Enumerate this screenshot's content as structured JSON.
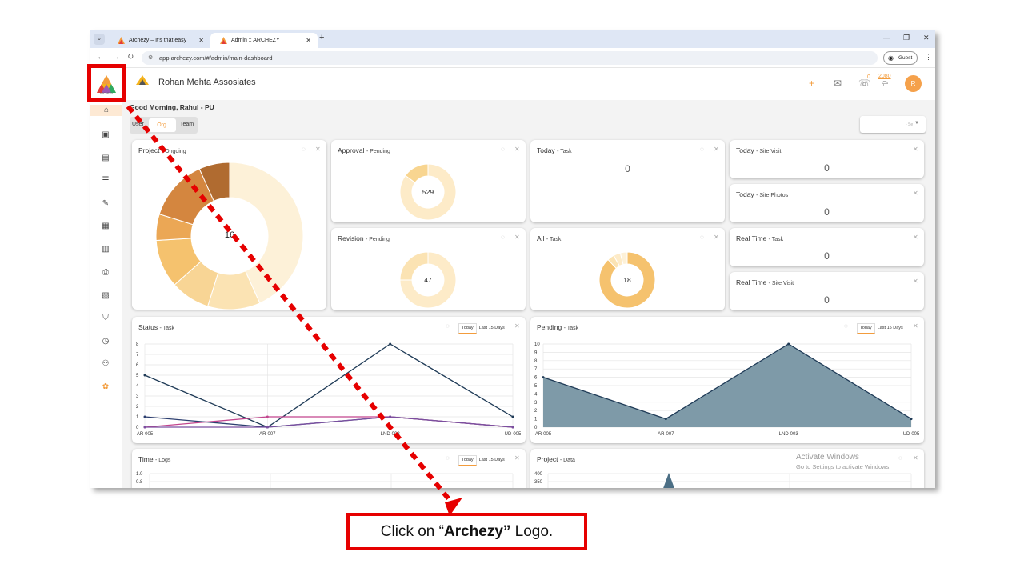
{
  "browser": {
    "tabs": [
      {
        "title": "Archezy – It's that easy",
        "active": false
      },
      {
        "title": "Admin :: ARCHEZY",
        "active": true
      }
    ],
    "url": "app.archezy.com/#/admin/main-dashboard",
    "profile_label": "Guest"
  },
  "sidebar": {
    "logo_text": "ARCHEZY",
    "items": [
      "home-icon",
      "badge-icon",
      "clipboard-clock-icon",
      "checklist-icon",
      "edit-note-icon",
      "receipt-icon",
      "book-icon",
      "printer-icon",
      "photo-folder-icon",
      "shield-icon",
      "calendar-clock-icon",
      "org-chart-icon",
      "gift-icon"
    ]
  },
  "header": {
    "company_name": "Rohan Mehta Assosiates",
    "notifications_count": "0",
    "alerts_count": "2080",
    "avatar_initial": "R",
    "accent_color": "#f39c3c"
  },
  "dashboard": {
    "greeting": "Good Morning, Rahul - PU",
    "scope_options": {
      "user": "User",
      "org": "Org.",
      "team": "Team"
    },
    "select_placeholder": "- Se"
  },
  "cards": {
    "project": {
      "title": "Project",
      "subtitle": "- Ongoing",
      "value": "16"
    },
    "approval": {
      "title": "Approval",
      "subtitle": "- Pending",
      "value": "529"
    },
    "revision": {
      "title": "Revision",
      "subtitle": "- Pending",
      "value": "47"
    },
    "today_task": {
      "title": "Today",
      "subtitle": "- Task",
      "value": "0"
    },
    "all_task": {
      "title": "All",
      "subtitle": "- Task",
      "value": "18"
    },
    "today_site_visit": {
      "title": "Today",
      "subtitle": "- Site Visit",
      "value": "0"
    },
    "today_site_photos": {
      "title": "Today",
      "subtitle": "- Site Photos",
      "value": "0"
    },
    "realtime_task": {
      "title": "Real Time",
      "subtitle": "- Task",
      "value": "0"
    },
    "realtime_site_visit": {
      "title": "Real Time",
      "subtitle": "- Site Visit",
      "value": "0"
    },
    "status_task": {
      "title": "Status",
      "subtitle": "- Task"
    },
    "pending_task": {
      "title": "Pending",
      "subtitle": "- Task"
    },
    "time_logs": {
      "title": "Time",
      "subtitle": "- Logs"
    },
    "project_data": {
      "title": "Project",
      "subtitle": "- Data"
    }
  },
  "range": {
    "today": "Today",
    "last15": "Last 15 Days"
  },
  "chart_data": [
    {
      "type": "pie",
      "values": [
        45,
        12,
        9,
        11,
        6,
        14,
        7
      ],
      "colors": [
        "#fdf1d8",
        "#fbe3b3",
        "#f8d595",
        "#f5c26e",
        "#eba755",
        "#d4863f",
        "#b06b30"
      ]
    },
    {
      "type": "pie",
      "values": [
        85,
        15
      ],
      "colors": [
        "#fdebc8",
        "#f8d590"
      ]
    },
    {
      "type": "pie",
      "values": [
        75,
        25
      ],
      "colors": [
        "#fdebc8",
        "#fbe3b3"
      ]
    },
    {
      "type": "pie",
      "values": [
        88,
        4,
        4,
        4
      ],
      "colors": [
        "#f5c26e",
        "#fbe3b3",
        "#fdebc8",
        "#fdf1d8"
      ]
    },
    {
      "type": "line",
      "categories": [
        "AR-005",
        "AR-007",
        "LND-003",
        "UD-005"
      ],
      "ylim": [
        0,
        8
      ],
      "yticks": [
        "0",
        "1",
        "2",
        "3",
        "4",
        "5",
        "6",
        "7",
        "8"
      ],
      "series": [
        {
          "values": [
            5,
            0,
            8,
            1
          ],
          "color": "#1f3b57"
        },
        {
          "values": [
            1,
            0,
            1,
            0
          ],
          "color": "#2d3f70"
        },
        {
          "values": [
            0,
            1,
            1,
            0
          ],
          "color": "#c2458e"
        },
        {
          "values": [
            0,
            0,
            1,
            0
          ],
          "color": "#7a4fa0"
        }
      ]
    },
    {
      "type": "area",
      "categories": [
        "AR-005",
        "AR-007",
        "LND-003",
        "UD-005"
      ],
      "ylim": [
        0,
        10
      ],
      "yticks": [
        "0",
        "1",
        "2",
        "3",
        "4",
        "5",
        "6",
        "7",
        "8",
        "9",
        "10"
      ],
      "series": [
        {
          "values": [
            6,
            1,
            10,
            1
          ],
          "color": "#1f3b57",
          "fill": "#7e9aa8"
        }
      ]
    },
    {
      "type": "line",
      "yticks": [
        "1.0",
        "0.8"
      ]
    },
    {
      "type": "line",
      "yticks": [
        "400",
        "350"
      ]
    }
  ],
  "watermark": {
    "line1": "Activate Windows",
    "line2": "Go to Settings to activate Windows."
  },
  "annotation": {
    "prefix": "Click on “",
    "bold": "Archezy”",
    "suffix": " Logo."
  }
}
